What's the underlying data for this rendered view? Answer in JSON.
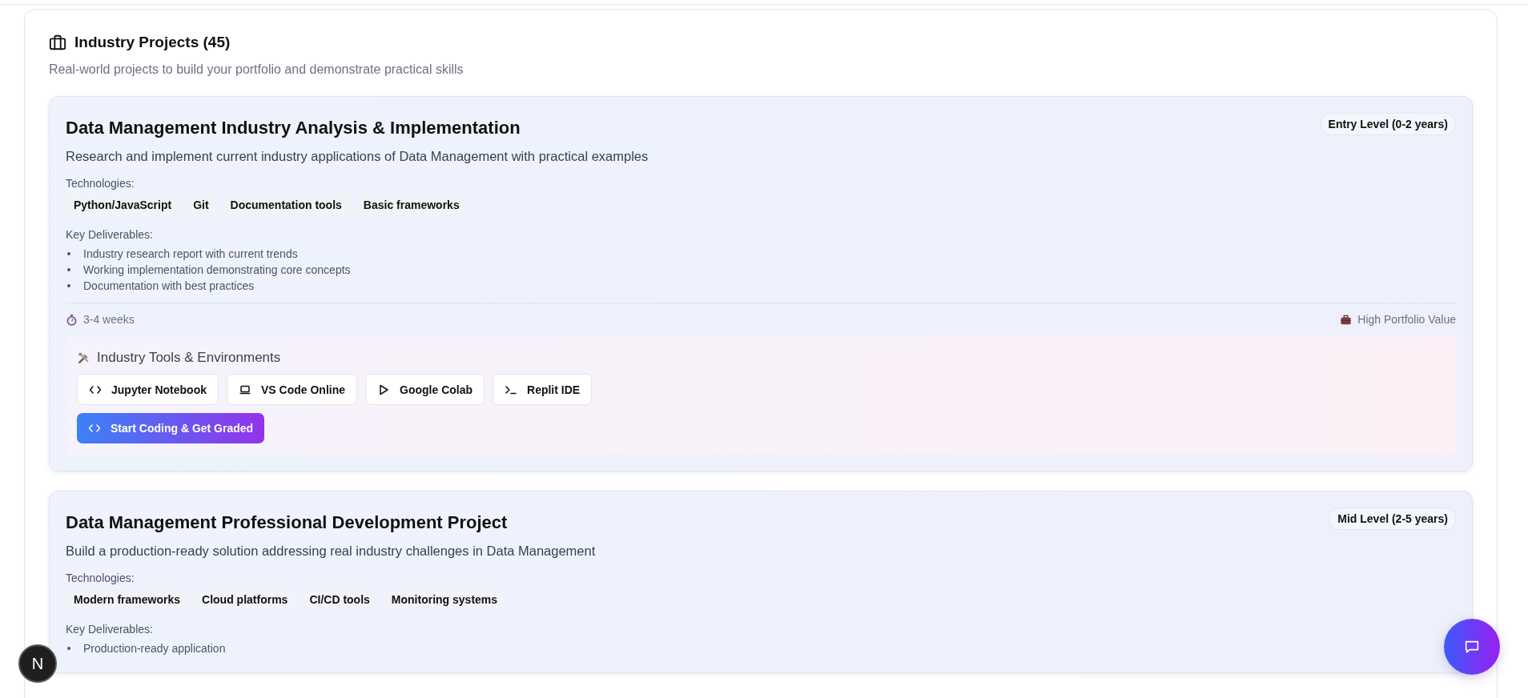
{
  "section": {
    "title": "Industry Projects (45)",
    "subtitle": "Real-world projects to build your portfolio and demonstrate practical skills"
  },
  "projects": [
    {
      "title": "Data Management Industry Analysis & Implementation",
      "level": "Entry Level (0-2 years)",
      "description": "Research and implement current industry applications of Data Management with practical examples",
      "technologies_label": "Technologies:",
      "technologies": [
        "Python/JavaScript",
        "Git",
        "Documentation tools",
        "Basic frameworks"
      ],
      "deliverables_label": "Key Deliverables:",
      "deliverables": [
        "Industry research report with current trends",
        "Working implementation demonstrating core concepts",
        "Documentation with best practices"
      ],
      "duration": "3-4 weeks",
      "value": "High Portfolio Value",
      "tools": {
        "title": "Industry Tools & Environments",
        "items": [
          {
            "kind": "code",
            "label": "Jupyter Notebook"
          },
          {
            "kind": "laptop",
            "label": "VS Code Online"
          },
          {
            "kind": "play",
            "label": "Google Colab"
          },
          {
            "kind": "terminal",
            "label": "Replit IDE"
          }
        ],
        "action": "Start Coding & Get Graded"
      }
    },
    {
      "title": "Data Management Professional Development Project",
      "level": "Mid Level (2-5 years)",
      "description": "Build a production-ready solution addressing real industry challenges in Data Management",
      "technologies_label": "Technologies:",
      "technologies": [
        "Modern frameworks",
        "Cloud platforms",
        "CI/CD tools",
        "Monitoring systems"
      ],
      "deliverables_label": "Key Deliverables:",
      "deliverables": [
        "Production-ready application"
      ]
    }
  ],
  "floating": {
    "badge": "N"
  }
}
